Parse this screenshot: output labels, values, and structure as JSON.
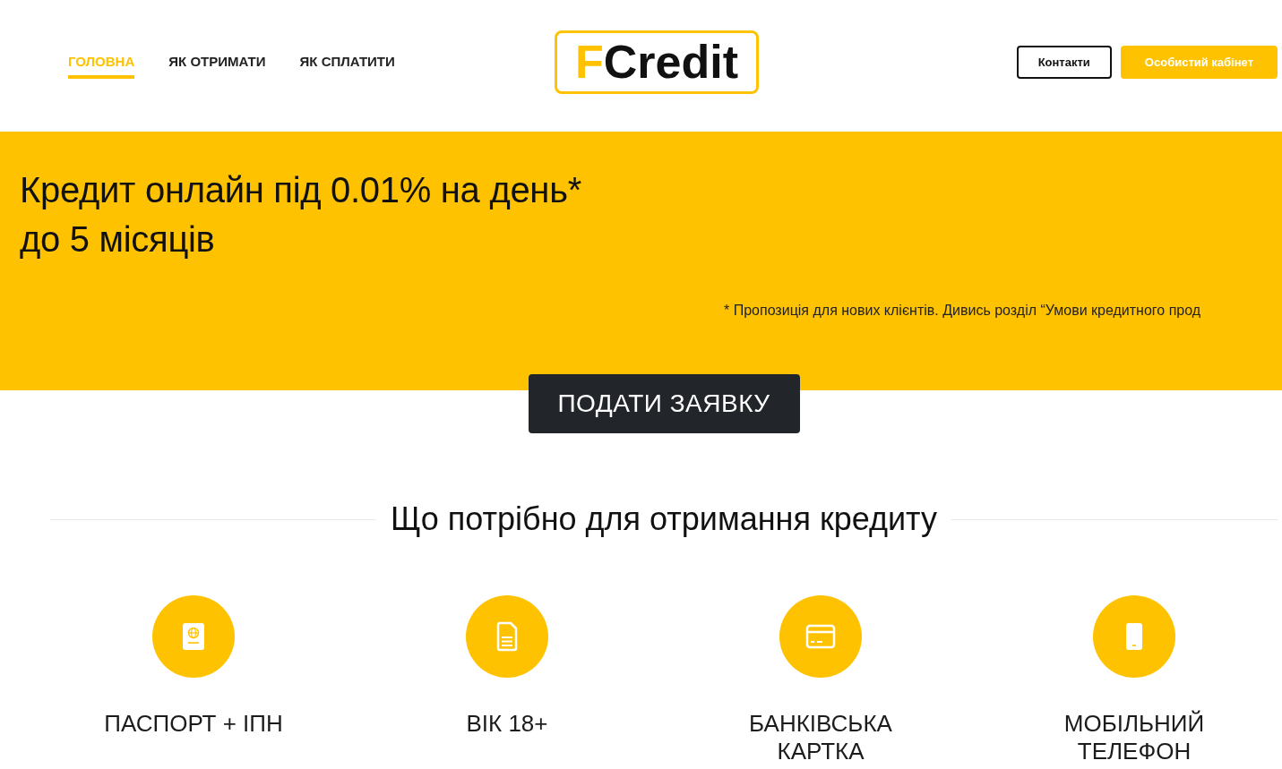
{
  "header": {
    "nav": [
      {
        "label": "ГОЛОВНА",
        "selected": true
      },
      {
        "label": "ЯК ОТРИМАТИ",
        "selected": false
      },
      {
        "label": "ЯК СПЛАТИТИ",
        "selected": false
      }
    ],
    "logo": {
      "accent": "F",
      "text": "Credit"
    },
    "buttons": [
      {
        "label": "Контакти",
        "kind": "outline"
      },
      {
        "label": "Особистий кабінет",
        "kind": "primary"
      }
    ]
  },
  "hero": {
    "title_lines": [
      "Кредит онлайн під 0.01% на день*",
      "до 5 місяців"
    ],
    "footnote": "* Пропозиція для нових клієнтів. Дивись розділ “Умови кредитного прод",
    "cta": "ПОДАТИ ЗАЯВКУ"
  },
  "requirements": {
    "title": "Що потрібно для отримання кредиту",
    "items": [
      {
        "label": "ПАСПОРТ + ІПН"
      },
      {
        "label": "ВІК 18+"
      },
      {
        "label": "БАНКІВСЬКА КАРТКА"
      },
      {
        "label": "МОБІЛЬНИЙ ТЕЛЕФОН"
      }
    ]
  }
}
